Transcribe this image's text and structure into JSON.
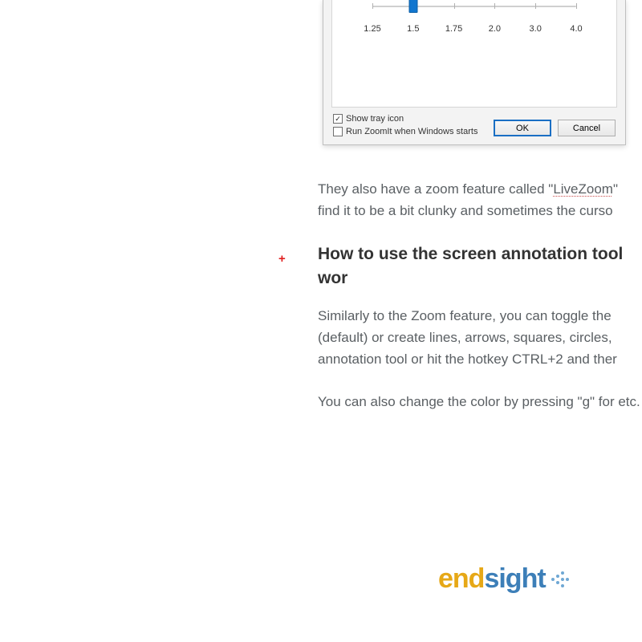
{
  "dialog": {
    "slider_ticks": [
      "1.25",
      "1.5",
      "1.75",
      "2.0",
      "3.0",
      "4.0"
    ],
    "slider_value_index": 1,
    "checkbox1": {
      "label": "Show tray icon",
      "checked": true
    },
    "checkbox2": {
      "label": "Run ZoomIt when Windows starts",
      "checked": false
    },
    "ok_label": "OK",
    "cancel_label": "Cancel"
  },
  "article": {
    "para1_pre": "They also have a zoom feature called \"",
    "para1_link": "LiveZoom",
    "para1_post": "\" find it to be a bit clunky and sometimes the curso",
    "heading": "How to use the screen annotation tool wor",
    "para2": "Similarly to the Zoom feature, you can toggle the (default) or create lines, arrows, squares, circles, annotation tool or hit the hotkey CTRL+2 and ther",
    "para3": "You can also change the color by pressing \"g\" for etc."
  },
  "plus_marker": "+",
  "logo": {
    "part1": "end",
    "part2": "sight"
  }
}
